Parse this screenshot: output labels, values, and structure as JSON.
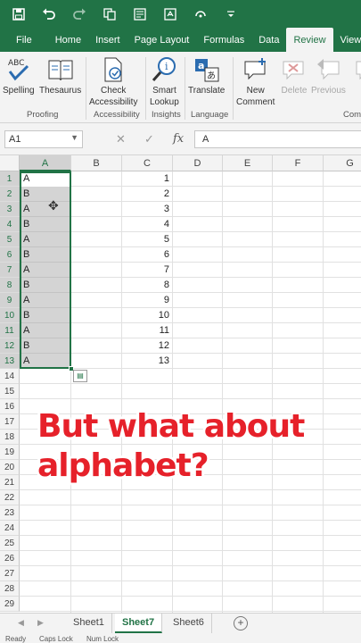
{
  "theme": {
    "accent": "#217346",
    "caption_color": "#e6212a"
  },
  "quick_access": {
    "icons": [
      "save-icon",
      "undo-icon",
      "redo-icon",
      "copy-icon",
      "print-preview-icon",
      "format-painter-icon",
      "touch-mode-icon",
      "customize-icon"
    ]
  },
  "tabs": [
    "File",
    "Home",
    "Insert",
    "Page Layout",
    "Formulas",
    "Data",
    "Review",
    "View"
  ],
  "active_tab": "Review",
  "ribbon": {
    "spelling": "Spelling",
    "thesaurus": "Thesaurus",
    "check_1": "Check",
    "check_2": "Accessibility",
    "smart_1": "Smart",
    "smart_2": "Lookup",
    "translate": "Translate",
    "new_1": "New",
    "new_2": "Comment",
    "delete": "Delete",
    "previous": "Previous",
    "next": "N",
    "groups": {
      "proofing": "Proofing",
      "accessibility": "Accessibility",
      "insights": "Insights",
      "language": "Language",
      "comments": "Com"
    }
  },
  "formula_bar": {
    "name_box": "A1",
    "cancel": "✕",
    "enter": "✓",
    "fx": "fx",
    "value": "A"
  },
  "columns": [
    "A",
    "B",
    "C",
    "D",
    "E",
    "F",
    "G"
  ],
  "rows": [
    "1",
    "2",
    "3",
    "4",
    "5",
    "6",
    "7",
    "8",
    "9",
    "10",
    "11",
    "12",
    "13",
    "14",
    "15",
    "16",
    "17",
    "18",
    "19",
    "20",
    "21",
    "22",
    "23",
    "24",
    "25",
    "26",
    "27",
    "28",
    "29"
  ],
  "column_a": [
    "A",
    "B",
    "A",
    "B",
    "A",
    "B",
    "A",
    "B",
    "A",
    "B",
    "A",
    "B",
    "A"
  ],
  "column_c": [
    "1",
    "2",
    "3",
    "4",
    "5",
    "6",
    "7",
    "8",
    "9",
    "10",
    "11",
    "12",
    "13"
  ],
  "caption": {
    "line1": "But what about",
    "line2": "alphabet?"
  },
  "sheets": [
    "Sheet1",
    "Sheet7",
    "Sheet6"
  ],
  "active_sheet": "Sheet7",
  "status": {
    "ready": "Ready",
    "caps": "Caps Lock",
    "num": "Num Lock"
  }
}
